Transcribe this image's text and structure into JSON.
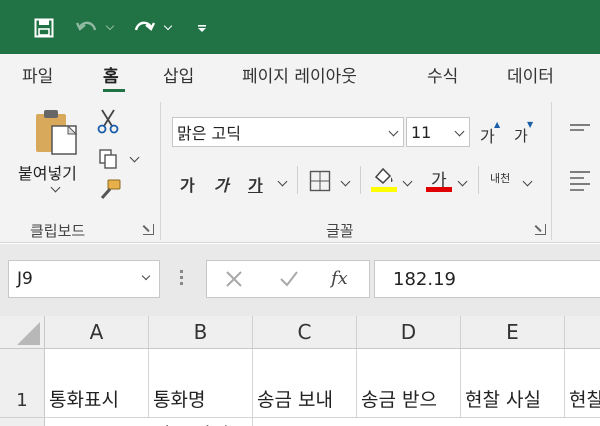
{
  "qat": {
    "save_icon": "save-icon",
    "undo_icon": "undo-icon",
    "redo_icon": "redo-icon",
    "customize_icon": "customize-qat-icon"
  },
  "tabs": [
    {
      "label": "파일"
    },
    {
      "label": "홈"
    },
    {
      "label": "삽입"
    },
    {
      "label": "페이지 레이아웃"
    },
    {
      "label": "수식"
    },
    {
      "label": "데이터"
    }
  ],
  "ribbon": {
    "clipboard": {
      "paste_label": "붙여넣기",
      "group_label": "클립보드"
    },
    "font": {
      "font_name": "맑은 고딕",
      "font_size": "11",
      "grow_label": "가",
      "shrink_label": "가",
      "bold_label": "가",
      "italic_label": "가",
      "underline_label": "가",
      "font_color_label": "가",
      "phonetic_label": "내천",
      "group_label": "글꼴",
      "fill_color": "#ffff00",
      "font_color": "#e00000"
    }
  },
  "formula_bar": {
    "name_box": "J9",
    "fx_label": "fx",
    "value": "182.19"
  },
  "sheet": {
    "columns": [
      "A",
      "B",
      "C",
      "D",
      "E"
    ],
    "rows": [
      {
        "num": "1",
        "cells": [
          "통화표시",
          "통화명",
          "송금 보내",
          "송금 받으",
          "현찰 사실",
          "현찰"
        ]
      }
    ],
    "row2_partial": "미국 달러"
  }
}
